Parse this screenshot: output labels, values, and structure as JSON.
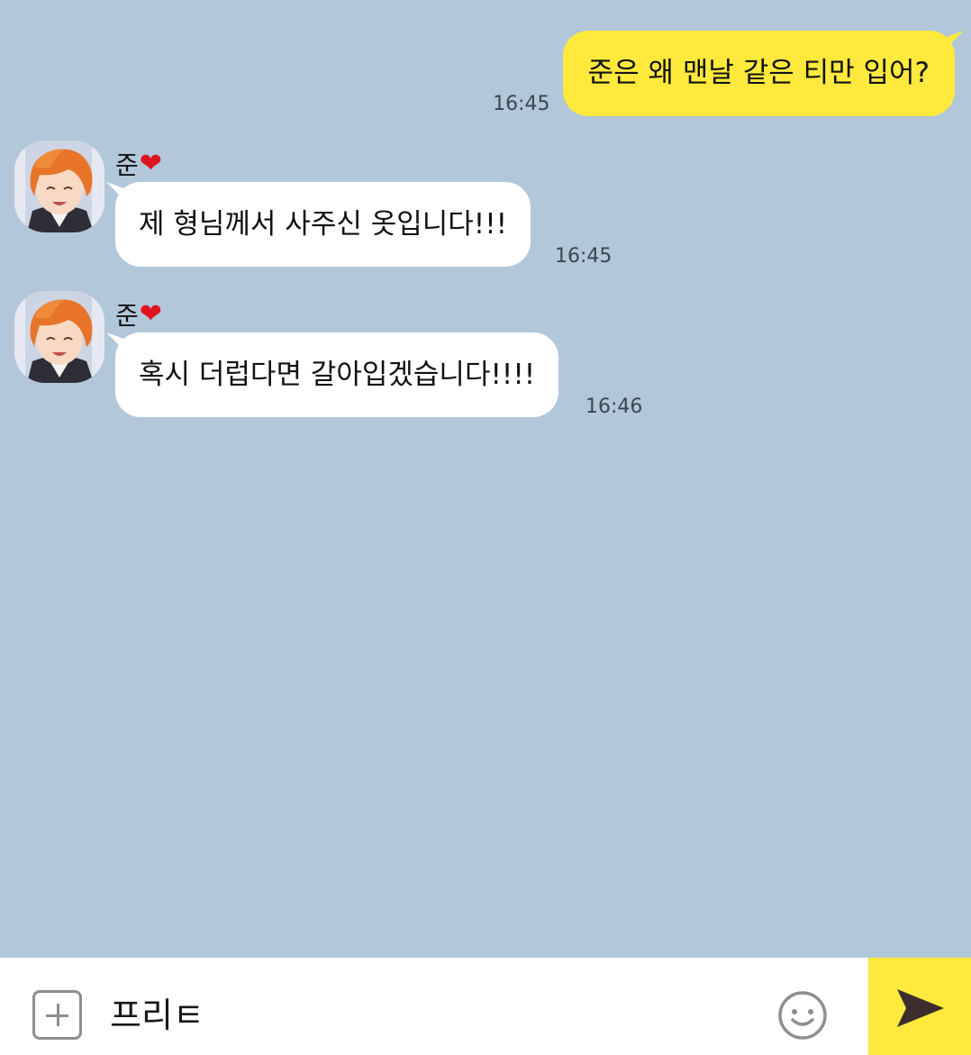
{
  "messages": {
    "outgoing": [
      {
        "text": "준은 왜 맨날 같은 티만 입어?",
        "time": "16:45"
      }
    ],
    "incoming": [
      {
        "sender": "준",
        "text": "제 형님께서 사주신 옷입니다!!!",
        "time": "16:45"
      },
      {
        "sender": "준",
        "text": "혹시 더럽다면 갈아입겠습니다!!!!",
        "time": "16:46"
      }
    ]
  },
  "input_bar": {
    "value": "프리ㅌ",
    "attach_icon": "plus-square-icon",
    "emoji_icon": "smiley-icon",
    "send_icon": "send-arrow-icon"
  },
  "colors": {
    "background": "#b2c7da",
    "outgoing_bubble": "#fee93c",
    "incoming_bubble": "#ffffff",
    "send_button": "#fee93c",
    "heart": "#e0141e"
  }
}
